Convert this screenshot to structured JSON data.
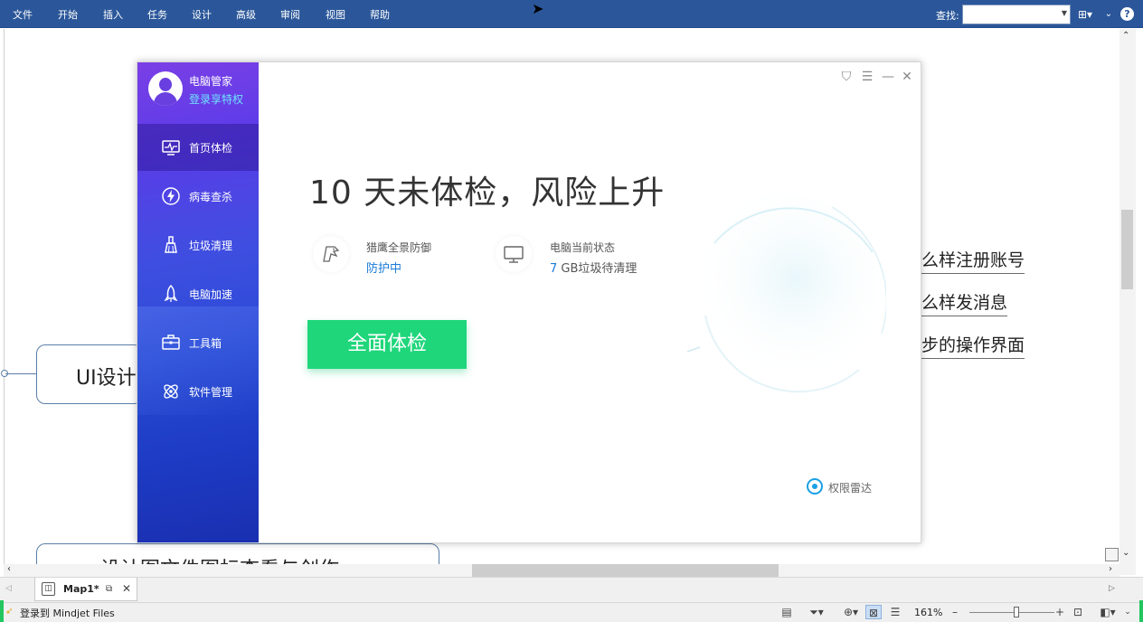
{
  "menubar": {
    "items": [
      "文件",
      "开始",
      "插入",
      "任务",
      "设计",
      "高级",
      "审阅",
      "视图",
      "帮助"
    ],
    "search_label": "查找:",
    "search_value": "",
    "help": "?"
  },
  "map": {
    "central_node": "UI设计",
    "bottom_node": "设计图文件图标查看与创作",
    "subtopics": [
      "怎么样注册账号",
      "怎么样发消息",
      "下一步的操作界面"
    ]
  },
  "tabs": {
    "active_label": "Map1*"
  },
  "statusbar": {
    "login_label": "登录到 Mindjet Files",
    "zoom": "161%"
  },
  "dialog": {
    "app_name": "电脑管家",
    "login_link": "登录享特权",
    "nav": [
      {
        "label": "首页体检",
        "icon": "monitor-pulse-icon",
        "active": true
      },
      {
        "label": "病毒查杀",
        "icon": "lightning-icon",
        "active": false
      },
      {
        "label": "垃圾清理",
        "icon": "broom-icon",
        "active": false
      },
      {
        "label": "电脑加速",
        "icon": "rocket-icon",
        "active": false
      },
      {
        "label": "工具箱",
        "icon": "toolbox-icon",
        "active": false
      },
      {
        "label": "软件管理",
        "icon": "apps-icon",
        "active": false
      }
    ],
    "headline": "10 天未体检，风险上升",
    "stats": [
      {
        "title": "猎鹰全景防御",
        "value": "防护中",
        "icon": "eagle-icon"
      },
      {
        "title": "电脑当前状态",
        "value_number": "7",
        "value_text": "GB垃圾待清理",
        "icon": "monitor-icon"
      }
    ],
    "scan_button": "全面体检",
    "brand": "权限雷达",
    "colors": {
      "accent_green": "#1fd67b",
      "link_blue": "#1a7bd8",
      "sidebar_top": "#7b3fe6",
      "sidebar_bottom": "#1a2fb0"
    }
  }
}
